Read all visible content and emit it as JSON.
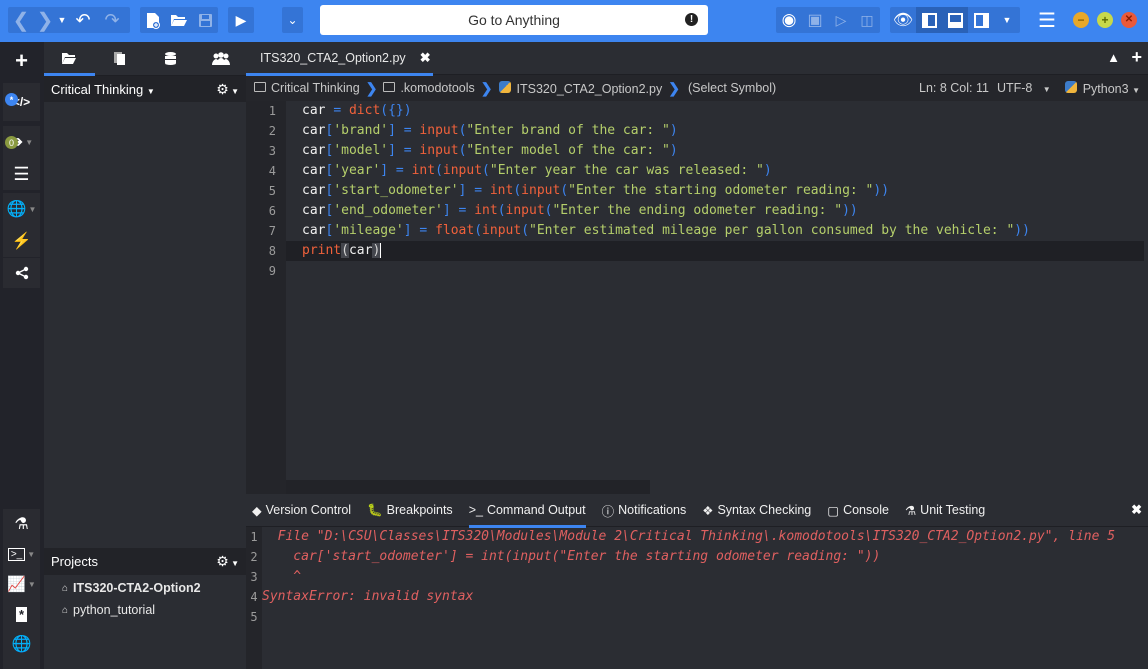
{
  "toolbar": {
    "goto_placeholder": "Go to Anything",
    "goto_alert": "!",
    "colors": {
      "bar": "#3d85f0",
      "group": "#3474d6",
      "minimize": "#e8a82a",
      "maximize": "#c7d94a",
      "close": "#ea5a3a"
    }
  },
  "leftbar": {
    "badge_star": "*",
    "badge_zero": "0"
  },
  "sidepanel": {
    "places_title": "Critical Thinking",
    "projects_title": "Projects",
    "projects": [
      {
        "label": "ITS320-CTA2-Option2",
        "bold": true
      },
      {
        "label": "python_tutorial",
        "bold": false
      }
    ]
  },
  "editor": {
    "tab_label": "ITS320_CTA2_Option2.py",
    "breadcrumbs": [
      "Critical Thinking",
      ".komodotools",
      "ITS320_CTA2_Option2.py",
      "(Select Symbol)"
    ],
    "cursor_pos": "Ln: 8 Col: 11",
    "encoding": "UTF-8",
    "language": "Python3",
    "line_numbers": [
      "1",
      "2",
      "3",
      "4",
      "5",
      "6",
      "7",
      "8",
      "9"
    ],
    "code": [
      [
        {
          "t": "v",
          "s": "car "
        },
        {
          "t": "o",
          "s": "= "
        },
        {
          "t": "k",
          "s": "dict"
        },
        {
          "t": "p",
          "s": "({})"
        }
      ],
      [
        {
          "t": "v",
          "s": "car"
        },
        {
          "t": "p",
          "s": "["
        },
        {
          "t": "s",
          "s": "'brand'"
        },
        {
          "t": "p",
          "s": "]"
        },
        {
          "t": "o",
          "s": " = "
        },
        {
          "t": "k",
          "s": "input"
        },
        {
          "t": "p",
          "s": "("
        },
        {
          "t": "s",
          "s": "\"Enter brand of the car: \""
        },
        {
          "t": "p",
          "s": ")"
        }
      ],
      [
        {
          "t": "v",
          "s": "car"
        },
        {
          "t": "p",
          "s": "["
        },
        {
          "t": "s",
          "s": "'model'"
        },
        {
          "t": "p",
          "s": "]"
        },
        {
          "t": "o",
          "s": " = "
        },
        {
          "t": "k",
          "s": "input"
        },
        {
          "t": "p",
          "s": "("
        },
        {
          "t": "s",
          "s": "\"Enter model of the car: \""
        },
        {
          "t": "p",
          "s": ")"
        }
      ],
      [
        {
          "t": "v",
          "s": "car"
        },
        {
          "t": "p",
          "s": "["
        },
        {
          "t": "s",
          "s": "'year'"
        },
        {
          "t": "p",
          "s": "]"
        },
        {
          "t": "o",
          "s": " = "
        },
        {
          "t": "k",
          "s": "int"
        },
        {
          "t": "p",
          "s": "("
        },
        {
          "t": "k",
          "s": "input"
        },
        {
          "t": "p",
          "s": "("
        },
        {
          "t": "s",
          "s": "\"Enter year the car was released: \""
        },
        {
          "t": "p",
          "s": ")"
        }
      ],
      [
        {
          "t": "v",
          "s": "car"
        },
        {
          "t": "p",
          "s": "["
        },
        {
          "t": "s",
          "s": "'start_odometer'"
        },
        {
          "t": "p",
          "s": "]"
        },
        {
          "t": "o",
          "s": " = "
        },
        {
          "t": "k",
          "s": "int"
        },
        {
          "t": "p",
          "s": "("
        },
        {
          "t": "k",
          "s": "input"
        },
        {
          "t": "p",
          "s": "("
        },
        {
          "t": "s",
          "s": "\"Enter the starting odometer reading: \""
        },
        {
          "t": "p",
          "s": "))"
        }
      ],
      [
        {
          "t": "v",
          "s": "car"
        },
        {
          "t": "p",
          "s": "["
        },
        {
          "t": "s",
          "s": "'end_odometer'"
        },
        {
          "t": "p",
          "s": "]"
        },
        {
          "t": "o",
          "s": " = "
        },
        {
          "t": "k",
          "s": "int"
        },
        {
          "t": "p",
          "s": "("
        },
        {
          "t": "k",
          "s": "input"
        },
        {
          "t": "p",
          "s": "("
        },
        {
          "t": "s",
          "s": "\"Enter the ending odometer reading: \""
        },
        {
          "t": "p",
          "s": "))"
        }
      ],
      [
        {
          "t": "v",
          "s": "car"
        },
        {
          "t": "p",
          "s": "["
        },
        {
          "t": "s",
          "s": "'mileage'"
        },
        {
          "t": "p",
          "s": "]"
        },
        {
          "t": "o",
          "s": " = "
        },
        {
          "t": "k",
          "s": "float"
        },
        {
          "t": "p",
          "s": "("
        },
        {
          "t": "k",
          "s": "input"
        },
        {
          "t": "p",
          "s": "("
        },
        {
          "t": "s",
          "s": "\"Enter estimated mileage per gallon consumed by the vehicle: \""
        },
        {
          "t": "p",
          "s": "))"
        }
      ],
      [
        {
          "t": "k",
          "s": "print"
        },
        {
          "t": "bm",
          "s": "("
        },
        {
          "t": "v",
          "s": "car"
        },
        {
          "t": "bm",
          "s": ")"
        },
        {
          "t": "caret",
          "s": ""
        }
      ],
      []
    ]
  },
  "bottom_panel": {
    "tabs": [
      "Version Control",
      "Breakpoints",
      "Command Output",
      "Notifications",
      "Syntax Checking",
      "Console",
      "Unit Testing"
    ],
    "active_tab": "Command Output",
    "output_line_numbers": [
      "1",
      "2",
      "3",
      "4",
      "5"
    ],
    "output": [
      "  File \"D:\\CSU\\Classes\\ITS320\\Modules\\Module 2\\Critical Thinking\\.komodotools\\ITS320_CTA2_Option2.py\", line 5",
      "    car['start_odometer'] = int(input(\"Enter the starting odometer reading: \"))",
      "    ^",
      "SyntaxError: invalid syntax",
      ""
    ]
  }
}
